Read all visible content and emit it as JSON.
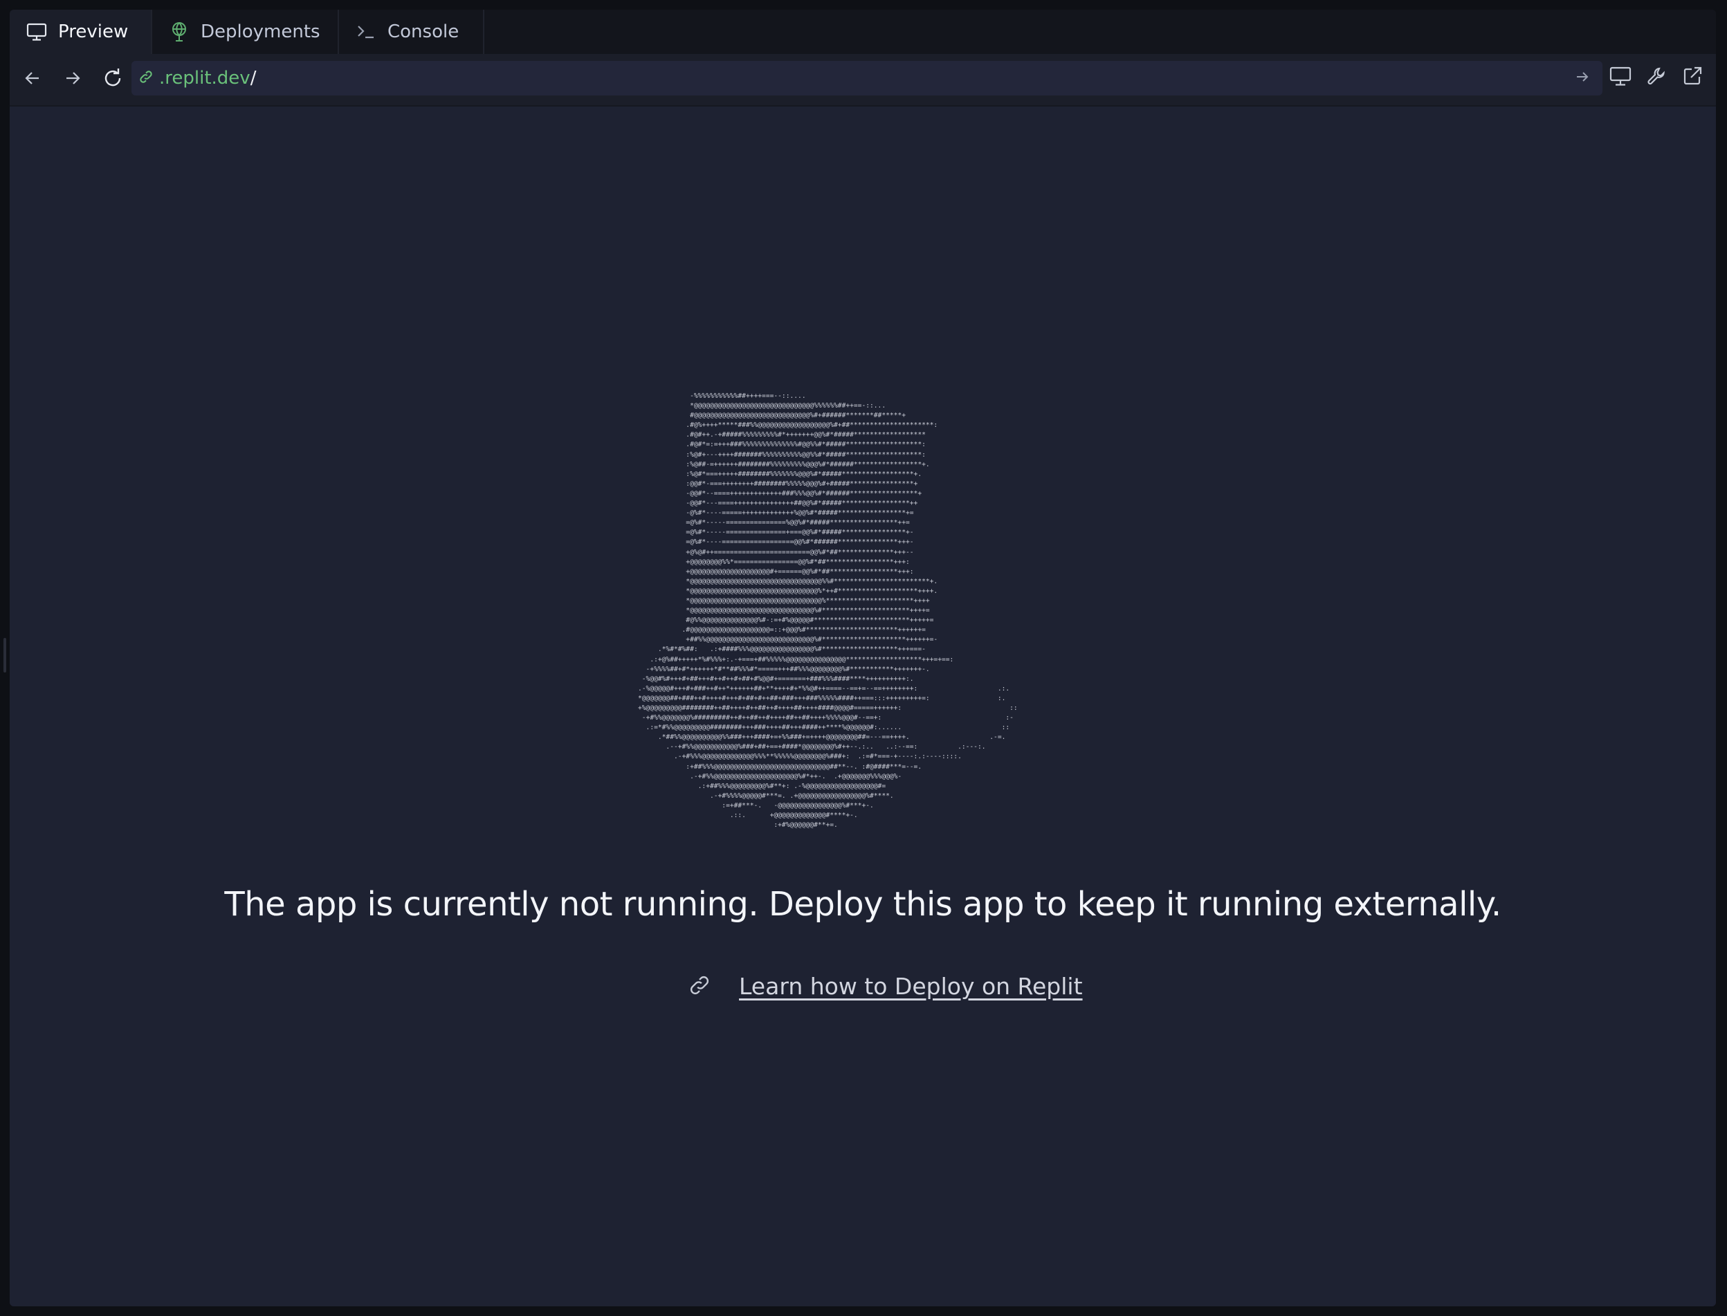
{
  "tabs": [
    {
      "label": "Preview",
      "icon": "monitor-icon",
      "active": true
    },
    {
      "label": "Deployments",
      "icon": "deploy-globe-icon",
      "active": false
    },
    {
      "label": "Console",
      "icon": "terminal-icon",
      "active": false
    }
  ],
  "address_bar": {
    "url_domain": ".replit.dev",
    "url_path": "/"
  },
  "main": {
    "headline": "The app is currently not running. Deploy this app to keep it running externally.",
    "learn_link": "Learn how to Deploy on Replit",
    "ascii_art": "             -%%%%%%%%%%%##++++===--::....\n             *@@@@@@@@@@@@@@@@@@@@@@@@@@@@@@%%%%%%##++==-::...\n             #@@@@@@@@@@@@@@@@@@@@@@@@@@@@@%#+######*******##*****+\n            .#@%++++*****###%%@@@@@@@@@@@@@@@@@@%#+##*********************:\n            .#@#++.-+#####%%%%%%%%%#*+++++++@@%#*#####******************\n            .#@#*=:=+++###%%%%%%%%%%%%%%#@@%%#*#####*******************:\n            :%@#+---++++#######%%%%%%%%%%@@%%#*#####*******************:\n            :%@##-=++++++########%%%%%%%%%@@@%#*######*****************+.\n            :%@#*===+++++########%%%%%%%@@@%#*#####******************+.\n            :@@#*-===++++++++########%%%%%@@@%#+#####****************+\n            -@@#*--====+++++++++++++###%%%@@%#*######*****************+\n            -@@#*---====+++++++++++++++##@@%#*#####*****************++\n            -@%#*----=====+++++++++++++%@@%#*#####*****************+=\n            =@%#*-----===============%@@%#*#####*****************++=\n            =@%#*-----===============+===@@%#*#####****************+-\n            =@%#*----==================@@%#*######***************+++-\n            +@%@#++========================@@%#*##**************+++--\n            +@@@@@@@@%%*================@@%#*##*****************+++:\n            +@@@@@@@@@@@@@@@@@@@@#+======@@%#*##*****************+++:\n            *@@@@@@@@@@@@@@@@@@@@@@@@@@@@@@@@@%%#************************+.\n            *@@@@@@@@@@@@@@@@@@@@@@@@@@@@@@@@%*++#********************++++.\n            *@@@@@@@@@@@@@@@@@@@@@@@@@@@@@@@@@%**********************++++\n            *@@@@@@@@@@@@@@@@@@@@@@@@@@@@@@@%#**********************++++=\n            #@%%@@@@@@@@@@@@@@%#-:=+#%@@@@@#************************+++++=\n           .#@@@@@@@@@@@@@@@@@@@@=::+@@@%#***********************++++++=\n            +##%%@@@@@@@@@@@@@@@@@@@@@@@@@@@%#*********************++++++=-\n     .*%#*#%##:   .:+####%%%@@@@@@@@@@@@@@@@%#*******************+++===-\n   .:+@%##+++++*%#%%%+:.-+===+##%%%%%@@@@@@@@@@@@@@@*******************+++=+==:\n  -+%%%%##+#*++++++*#**##%%%#*=====+++##%%%@@@@@@@@%#***********+++++++-.\n -%@@#%#+++#+##+++#++#++#+##+#%@@#+=======+###%%%####****++++++++++:.\n.-%@@@@@#+++#+###++#++*++++++##+**++++#+*%%@#++====--==+=--==++++++++:                    .:.\n*@@@@@@@##+###++#++++#+++#+##+#++##+###+++###%%%%%####++===:::+++++++++=:                 :.\n+%@@@@@@@@@########++##++++#++##++#++++##++++####@@@@#=====++++++:                           ::\n -+#%%@@@@@@@%#########++#++##++#++++##++##++++%%%%@@@#--==+:                               :-\n  .:=*#%%@@@@@@@@@########+++###++++##+++####++****%@@@@@@#:......                         ::\n     .*##%%@@@@@@@@@@%%###+++####+=+%%###+=++++@@@@@@@@##=---==++++.                    .-=.\n       .--+#%%@@@@@@@@@@@%###+##+==+####*@@@@@@@@%#++--.:..   ..:--==:          .:---:.\n         .-+#%%%@@@@@@@@@@@@@%%%**%%%%%@@@@@@@@%###+:  .:=#*===-+----:.:----::::.\n            :+##%%%@@@@@@@@@@@@@@@@@@@@@@@@@@@@@##**--. :#@####***=--=.\n             .-+#%%@@@@@@@@@@@@@@@@@@@@@%#*++-.  .+@@@@@@@%%%@@@%-\n               .:+##%%%@@@@@@@@@%#**+: .-%@@@@@@@@@@@@@@@@@@#=\n                  .-+#%%%%@@@@@#***=. .+@@@@@@@@@@@@@@@@@%#****.\n                     :=+##***-.   -@@@@@@@@@@@@@@@@%#***+-.\n                       .::.      +@@@@@@@@@@@@@#****+-.\n                                  :+#%@@@@@@#**+=."
  }
}
